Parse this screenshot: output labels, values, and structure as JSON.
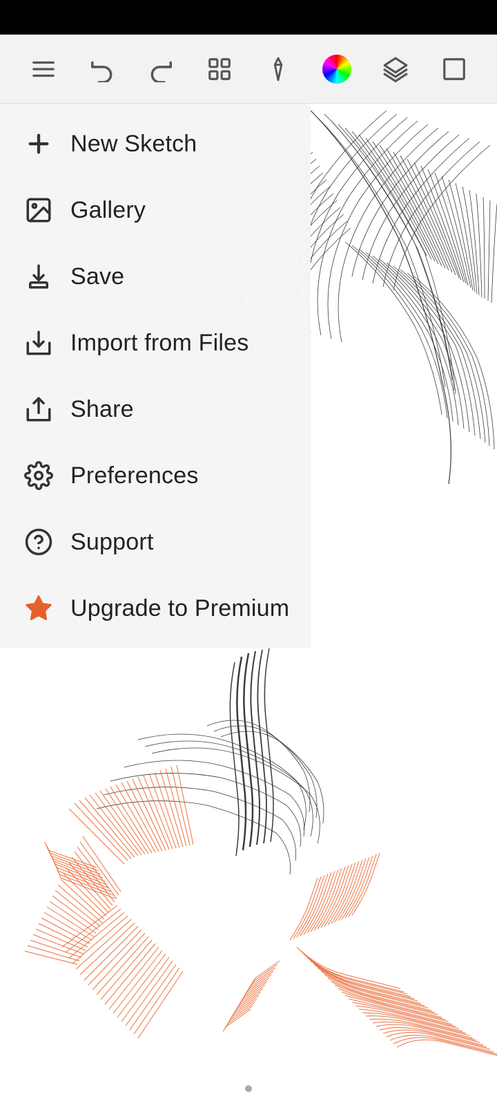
{
  "statusBar": {},
  "toolbar": {
    "buttons": [
      {
        "name": "menu-icon",
        "label": "Menu"
      },
      {
        "name": "undo-icon",
        "label": "Undo"
      },
      {
        "name": "redo-icon",
        "label": "Redo"
      },
      {
        "name": "grid-icon",
        "label": "Grid"
      },
      {
        "name": "pen-icon",
        "label": "Pen Tool"
      },
      {
        "name": "color-wheel-icon",
        "label": "Color Wheel"
      },
      {
        "name": "layers-icon",
        "label": "Layers"
      },
      {
        "name": "selection-icon",
        "label": "Selection"
      }
    ]
  },
  "menu": {
    "items": [
      {
        "id": "new-sketch",
        "label": "New Sketch",
        "icon": "plus"
      },
      {
        "id": "gallery",
        "label": "Gallery",
        "icon": "gallery"
      },
      {
        "id": "save",
        "label": "Save",
        "icon": "save"
      },
      {
        "id": "import-from-files",
        "label": "Import from Files",
        "icon": "import"
      },
      {
        "id": "share",
        "label": "Share",
        "icon": "share"
      },
      {
        "id": "preferences",
        "label": "Preferences",
        "icon": "gear"
      },
      {
        "id": "support",
        "label": "Support",
        "icon": "help"
      },
      {
        "id": "upgrade",
        "label": "Upgrade to Premium",
        "icon": "star"
      }
    ]
  }
}
